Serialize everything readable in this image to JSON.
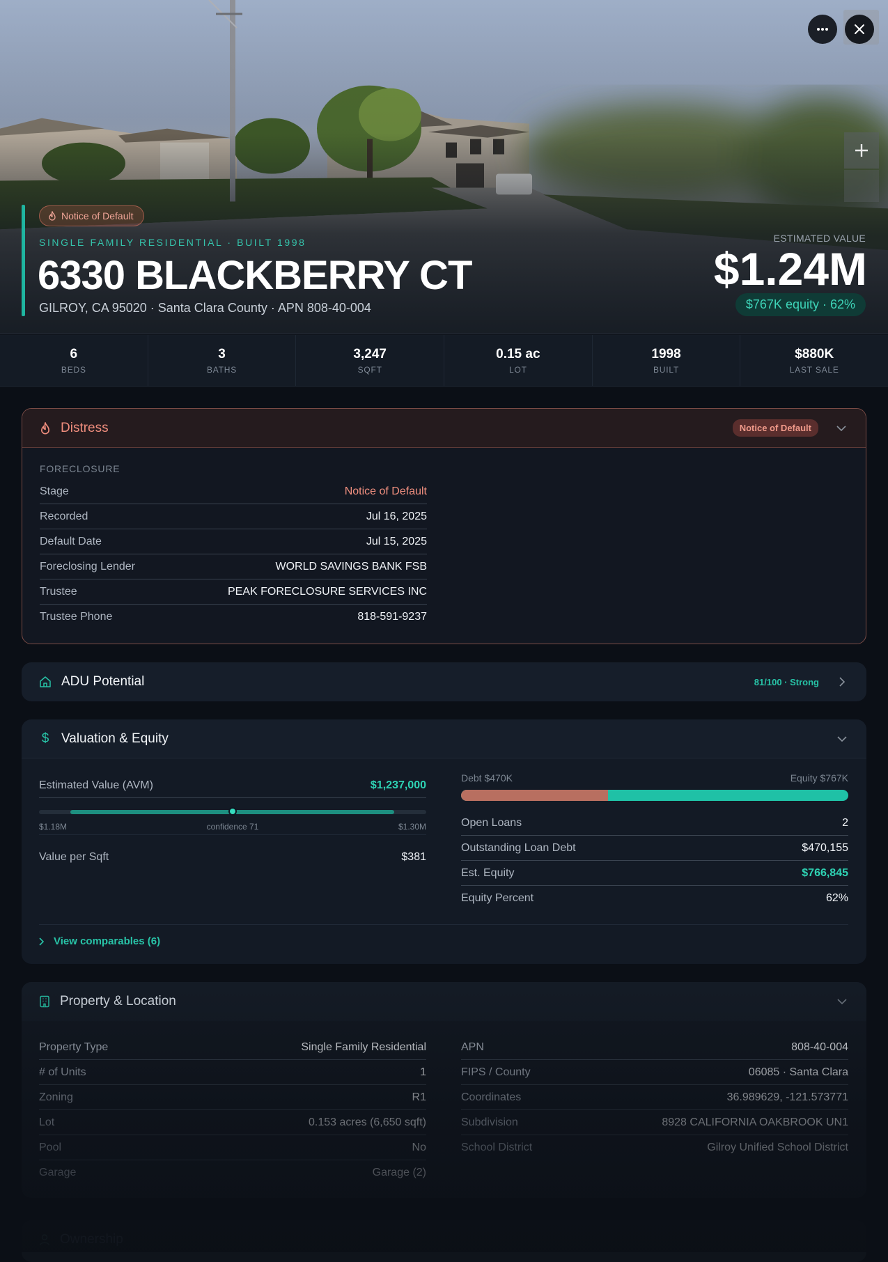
{
  "hero": {
    "badge": "Notice of Default",
    "kicker": "SINGLE FAMILY RESIDENTIAL · BUILT 1998",
    "address": "6330 BLACKBERRY CT",
    "subline": "GILROY, CA 95020 · Santa Clara County · APN 808-40-004",
    "estimated_label": "ESTIMATED VALUE",
    "estimated_value": "$1.24M",
    "equity_pill": "$767K equity · 62%"
  },
  "stats": [
    {
      "value": "6",
      "label": "BEDS"
    },
    {
      "value": "3",
      "label": "BATHS"
    },
    {
      "value": "3,247",
      "label": "SQFT"
    },
    {
      "value": "0.15 ac",
      "label": "LOT"
    },
    {
      "value": "1998",
      "label": "BUILT"
    },
    {
      "value": "$880K",
      "label": "LAST SALE"
    }
  ],
  "distress": {
    "title": "Distress",
    "badge": "Notice of Default",
    "section": "FORECLOSURE",
    "rows": [
      {
        "k": "Stage",
        "v": "Notice of Default"
      },
      {
        "k": "Recorded",
        "v": "Jul 16, 2025"
      },
      {
        "k": "Default Date",
        "v": "Jul 15, 2025"
      },
      {
        "k": "Foreclosing Lender",
        "v": "WORLD SAVINGS BANK FSB"
      },
      {
        "k": "Trustee",
        "v": "PEAK FORECLOSURE SERVICES INC"
      },
      {
        "k": "Trustee Phone",
        "v": "818-591-9237"
      }
    ]
  },
  "adu": {
    "title": "ADU Potential",
    "score": "81/100 · Strong"
  },
  "valuation": {
    "title": "Valuation & Equity",
    "avm_label": "Estimated Value (AVM)",
    "avm_value": "$1,237,000",
    "range_low": "$1.18M",
    "range_confidence": "confidence 71",
    "range_high": "$1.30M",
    "range_position": 0.5,
    "vps_label": "Value per Sqft",
    "vps_value": "$381",
    "debt_label": "Debt $470K",
    "equity_label": "Equity $767K",
    "debt_fraction": 0.38,
    "rows": [
      {
        "k": "Open Loans",
        "v": "2"
      },
      {
        "k": "Outstanding Loan Debt",
        "v": "$470,155"
      },
      {
        "k": "Est. Equity",
        "v": "$766,845"
      },
      {
        "k": "Equity Percent",
        "v": "62%"
      }
    ],
    "comps_link": "View comparables (6)"
  },
  "property": {
    "title": "Property & Location",
    "left": [
      {
        "k": "Property Type",
        "v": "Single Family Residential"
      },
      {
        "k": "# of Units",
        "v": "1"
      },
      {
        "k": "Zoning",
        "v": "R1"
      },
      {
        "k": "Lot",
        "v": "0.153 acres (6,650 sqft)"
      },
      {
        "k": "Pool",
        "v": "No"
      },
      {
        "k": "Garage",
        "v": "Garage (2)"
      }
    ],
    "right": [
      {
        "k": "APN",
        "v": "808-40-004"
      },
      {
        "k": "FIPS / County",
        "v": "06085 · Santa Clara"
      },
      {
        "k": "Coordinates",
        "v": "36.989629, -121.573771"
      },
      {
        "k": "Subdivision",
        "v": "8928 CALIFORNIA OAKBROOK UN1"
      },
      {
        "k": "School District",
        "v": "Gilroy Unified School District"
      }
    ]
  },
  "ownership": {
    "title": "Ownership"
  },
  "colors": {
    "accent": "#1fb5a0",
    "distress": "#ef8d7d",
    "debt": "#b86f60"
  }
}
